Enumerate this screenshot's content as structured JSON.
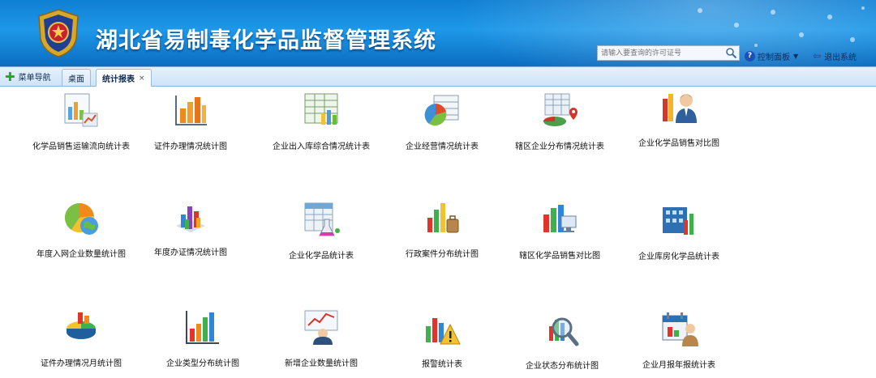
{
  "header": {
    "title": "湖北省易制毒化学品监督管理系统",
    "search_placeholder": "请输入要查询的许可证号",
    "control_panel_label": "控制面板",
    "logout_label": "退出系统"
  },
  "tabbar": {
    "menu_nav_label": "菜单导航",
    "tabs": [
      {
        "label": "桌面"
      },
      {
        "label": "统计报表"
      }
    ],
    "close_glyph": "×"
  },
  "reports": {
    "row1": [
      {
        "label": "化学品销售运输流向统计表",
        "icon": "report-chart-icon"
      },
      {
        "label": "证件办理情况统计图",
        "icon": "bar-chart-icon"
      },
      {
        "label": "企业出入库综合情况统计表",
        "icon": "spreadsheet-chart-icon"
      },
      {
        "label": "企业经营情况统计表",
        "icon": "pie-table-icon"
      },
      {
        "label": "辖区企业分布情况统计表",
        "icon": "map-pin-table-icon"
      },
      {
        "label": "企业化学品销售对比图",
        "icon": "person-chart-icon"
      }
    ],
    "row2": [
      {
        "label": "年度入网企业数量统计图",
        "icon": "pie-globe-icon"
      },
      {
        "label": "年度办证情况统计图",
        "icon": "bar-3d-icon"
      },
      {
        "label": "企业化学品统计表",
        "icon": "flask-table-icon"
      },
      {
        "label": "行政案件分布统计图",
        "icon": "bar-briefcase-icon"
      },
      {
        "label": "辖区化学品销售对比图",
        "icon": "bar-monitor-icon"
      },
      {
        "label": "企业库房化学品统计表",
        "icon": "building-chart-icon"
      }
    ],
    "row3": [
      {
        "label": "证件办理情况月统计图",
        "icon": "pie-3d-icon"
      },
      {
        "label": "企业类型分布统计图",
        "icon": "bar-chart-blue-icon"
      },
      {
        "label": "新增企业数量统计图",
        "icon": "presenter-chart-icon"
      },
      {
        "label": "报警统计表",
        "icon": "warning-chart-icon"
      },
      {
        "label": "企业状态分布统计图",
        "icon": "magnifier-chart-icon"
      },
      {
        "label": "企业月报年报统计表",
        "icon": "calendar-person-icon"
      }
    ]
  },
  "colors": {
    "banner": "#1e98e8",
    "tabbar": "#d9e8f8",
    "accent_green": "#2aa12a",
    "text": "#111111"
  }
}
